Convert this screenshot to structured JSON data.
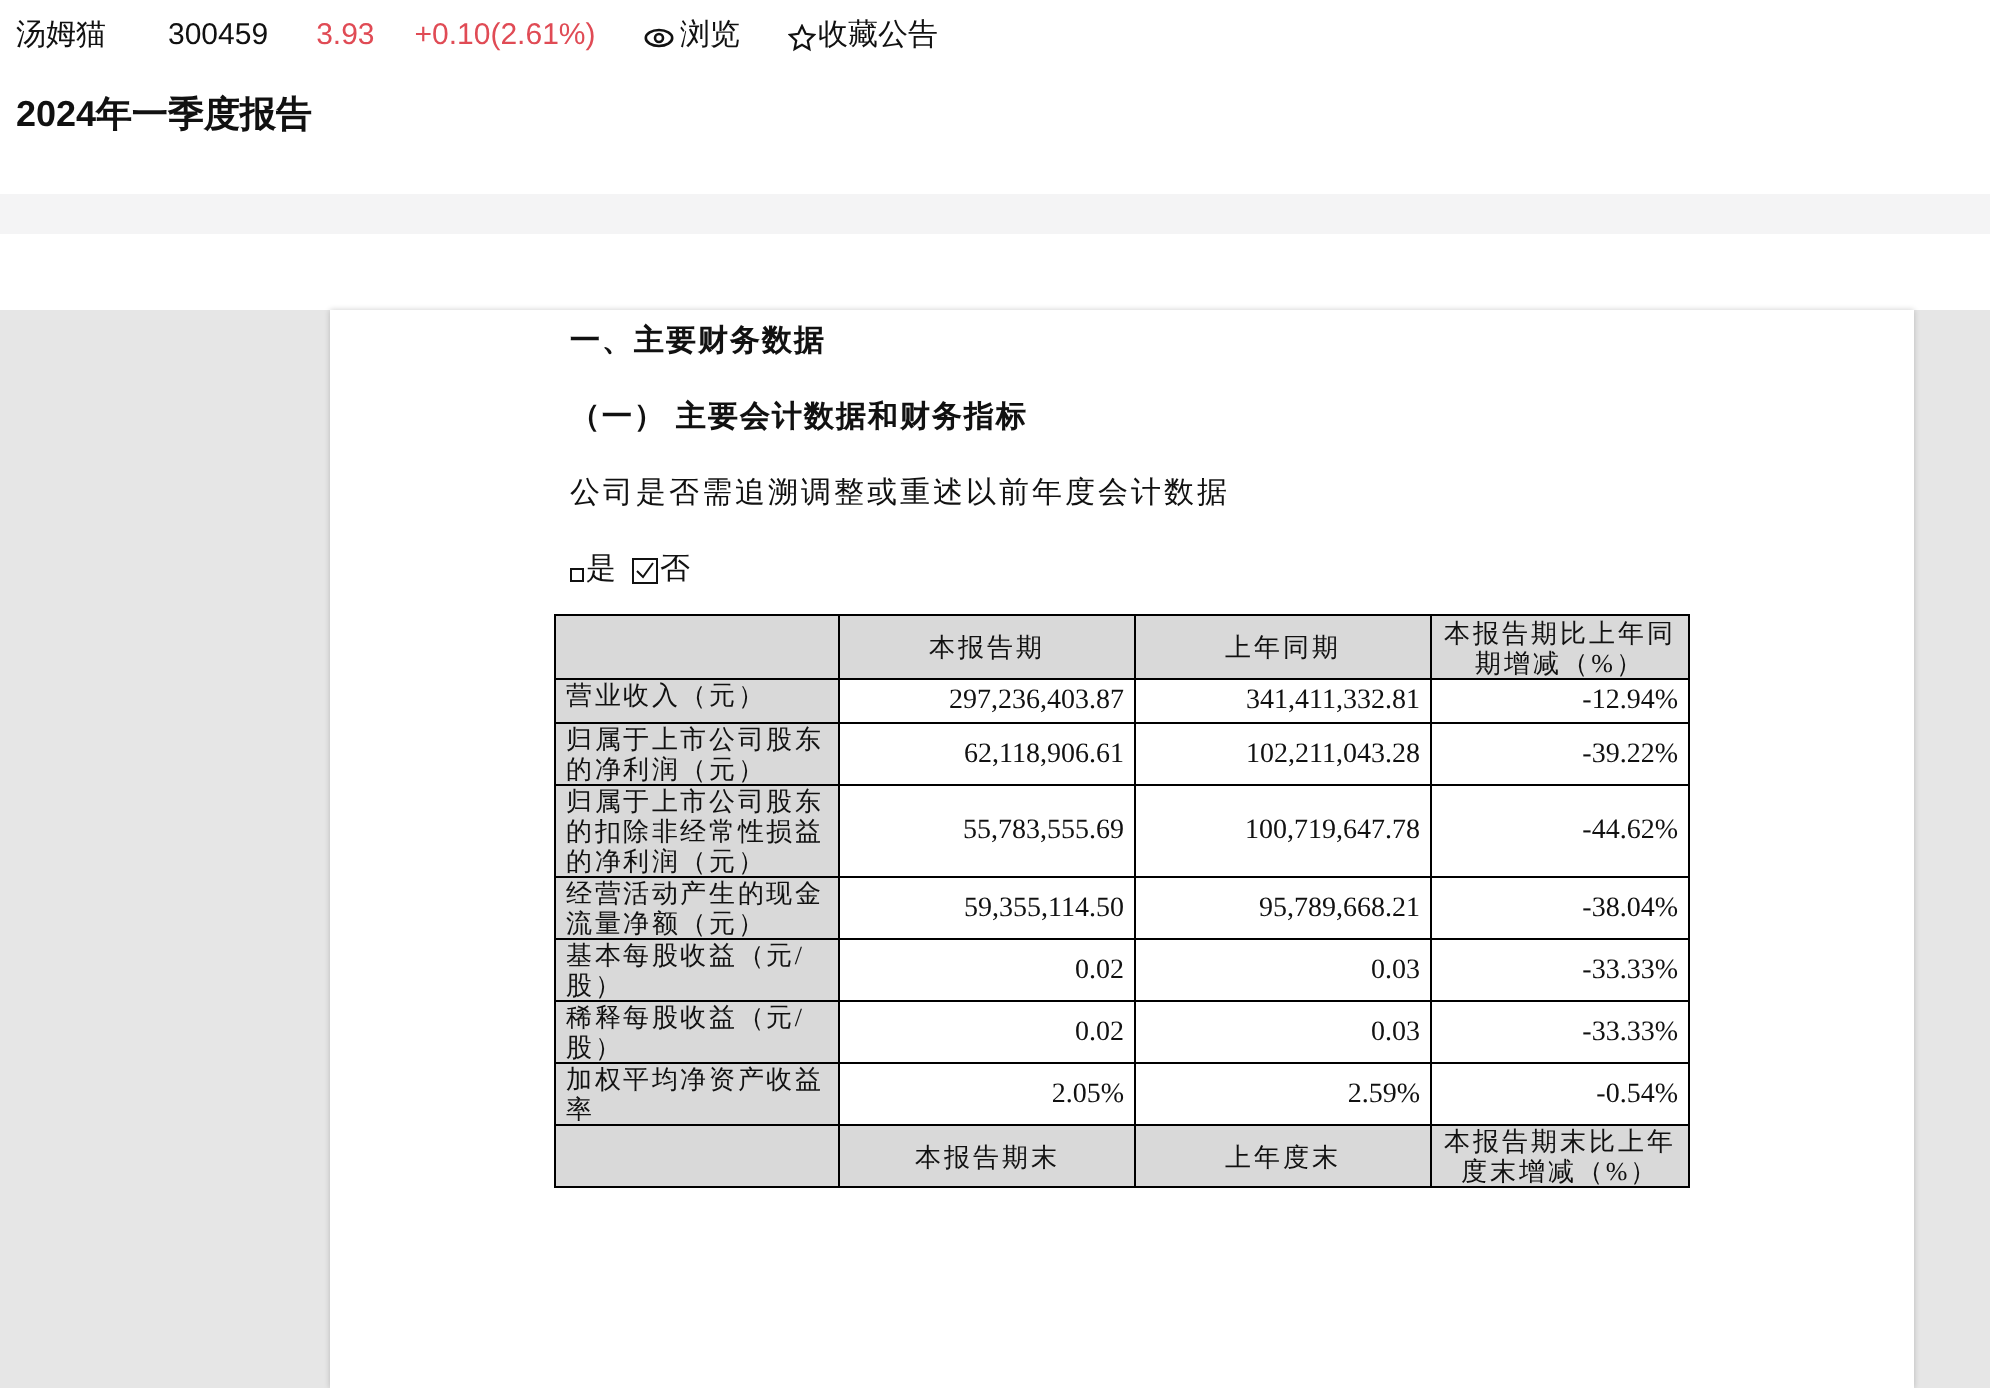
{
  "stock": {
    "name": "汤姆猫",
    "code": "300459",
    "price": "3.93",
    "change": "+0.10(2.61%)",
    "browse": "浏览",
    "favorite": "收藏公告"
  },
  "title": "2024年一季度报告",
  "document": {
    "section": "一、主要财务数据",
    "subsection": "（一） 主要会计数据和财务指标",
    "question": "公司是否需追溯调整或重述以前年度会计数据",
    "options": [
      {
        "label": "是",
        "checked": false
      },
      {
        "label": "否",
        "checked": true
      }
    ],
    "table": {
      "columns": [
        "本报告期",
        "上年同期",
        "本报告期比上年同期增减（%）"
      ],
      "rows": [
        {
          "label": "营业收入（元）",
          "values": [
            "297,236,403.87",
            "341,411,332.81",
            "-12.94%"
          ]
        },
        {
          "label": "归属于上市公司股东的净利润（元）",
          "values": [
            "62,118,906.61",
            "102,211,043.28",
            "-39.22%"
          ]
        },
        {
          "label": "归属于上市公司股东的扣除非经常性损益的净利润（元）",
          "values": [
            "55,783,555.69",
            "100,719,647.78",
            "-44.62%"
          ]
        },
        {
          "label": "经营活动产生的现金流量净额（元）",
          "values": [
            "59,355,114.50",
            "95,789,668.21",
            "-38.04%"
          ]
        },
        {
          "label": "基本每股收益（元/股）",
          "values": [
            "0.02",
            "0.03",
            "-33.33%"
          ]
        },
        {
          "label": "稀释每股收益（元/股）",
          "values": [
            "0.02",
            "0.03",
            "-33.33%"
          ]
        },
        {
          "label": "加权平均净资产收益率",
          "values": [
            "2.05%",
            "2.59%",
            "-0.54%"
          ]
        }
      ],
      "footer_columns": [
        "本报告期末",
        "上年度末",
        "本报告期末比上年度末增减（%）"
      ]
    }
  }
}
